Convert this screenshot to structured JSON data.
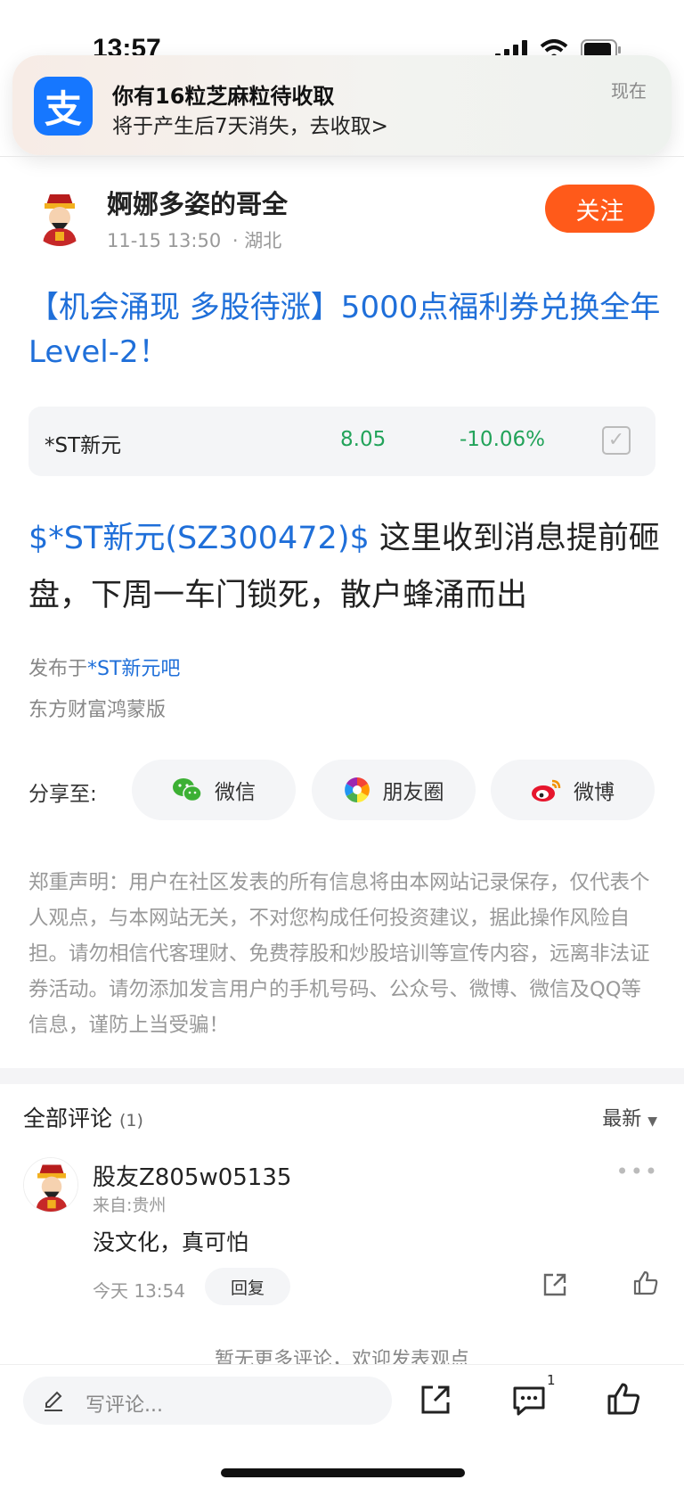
{
  "status_bar": {
    "time": "13:57"
  },
  "notification": {
    "app_icon_char": "支",
    "title": "你有16粒芝麻粒待收取",
    "body": "将于产生后7天消失，去收取>",
    "time": "现在"
  },
  "post": {
    "author": "婀娜多姿的哥全",
    "datetime": "11-15 13:50",
    "location": "· 湖北",
    "follow_label": "关注",
    "promo_title": "【机会涌现 多股待涨】5000点福利券兑换全年Level-2！",
    "stock": {
      "name": "*ST新元",
      "price": "8.05",
      "change": "-10.06%"
    },
    "tag": "$*ST新元(SZ300472)$",
    "body": " 这里收到消息提前砸盘，下周一车门锁死，散户蜂涌而出",
    "published_prefix": "发布于",
    "published_link": "*ST新元吧",
    "source": "东方财富鸿蒙版"
  },
  "share": {
    "label": "分享至:",
    "buttons": [
      {
        "label": "微信",
        "icon": "wechat-icon"
      },
      {
        "label": "朋友圈",
        "icon": "moments-icon"
      },
      {
        "label": "微博",
        "icon": "weibo-icon"
      }
    ]
  },
  "disclaimer": "郑重声明：用户在社区发表的所有信息将由本网站记录保存，仅代表个人观点，与本网站无关，不对您构成任何投资建议，据此操作风险自担。请勿相信代客理财、免费荐股和炒股培训等宣传内容，远离非法证券活动。请勿添加发言用户的手机号码、公众号、微博、微信及QQ等信息，谨防上当受骗！",
  "comments": {
    "title": "全部评论",
    "count": "(1)",
    "sort": "最新",
    "items": [
      {
        "user": "股友Z805w05135",
        "location": "来自:贵州",
        "text": "没文化，真可怕",
        "time": "今天 13:54",
        "reply_label": "回复"
      }
    ],
    "no_more": "暂无更多评论，欢迎发表观点"
  },
  "bottom_bar": {
    "write_placeholder": "写评论...",
    "comment_badge": "1"
  },
  "colors": {
    "link_blue": "#1f6fd9",
    "follow_orange": "#ff5a1a",
    "stock_green": "#22a35a",
    "alipay_blue": "#1677ff"
  }
}
